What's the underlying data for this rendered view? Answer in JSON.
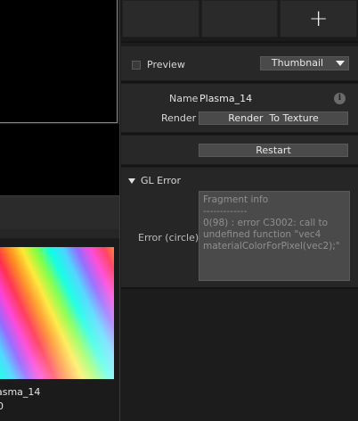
{
  "thumbnail": {
    "name": "asma_14",
    "sub": "0"
  },
  "toolbar": {
    "tiles": [
      "",
      "",
      "+"
    ]
  },
  "preview_row": {
    "label": "Preview",
    "checked": false,
    "view_mode": "Thumbnail"
  },
  "properties": {
    "name_label": "Name",
    "name_value": "Plasma_14",
    "info_icon": "i",
    "render_label": "Render",
    "render_value": "Render  To Texture"
  },
  "actions": {
    "restart_label": "Restart"
  },
  "gl_error": {
    "title": "GL Error",
    "expanded": true,
    "field_label": "Error (circle)",
    "message": "Fragment info\n-------------\n0(98) : error C3002: call to undefined function \"vec4 materialColorForPixel(vec2);\""
  }
}
